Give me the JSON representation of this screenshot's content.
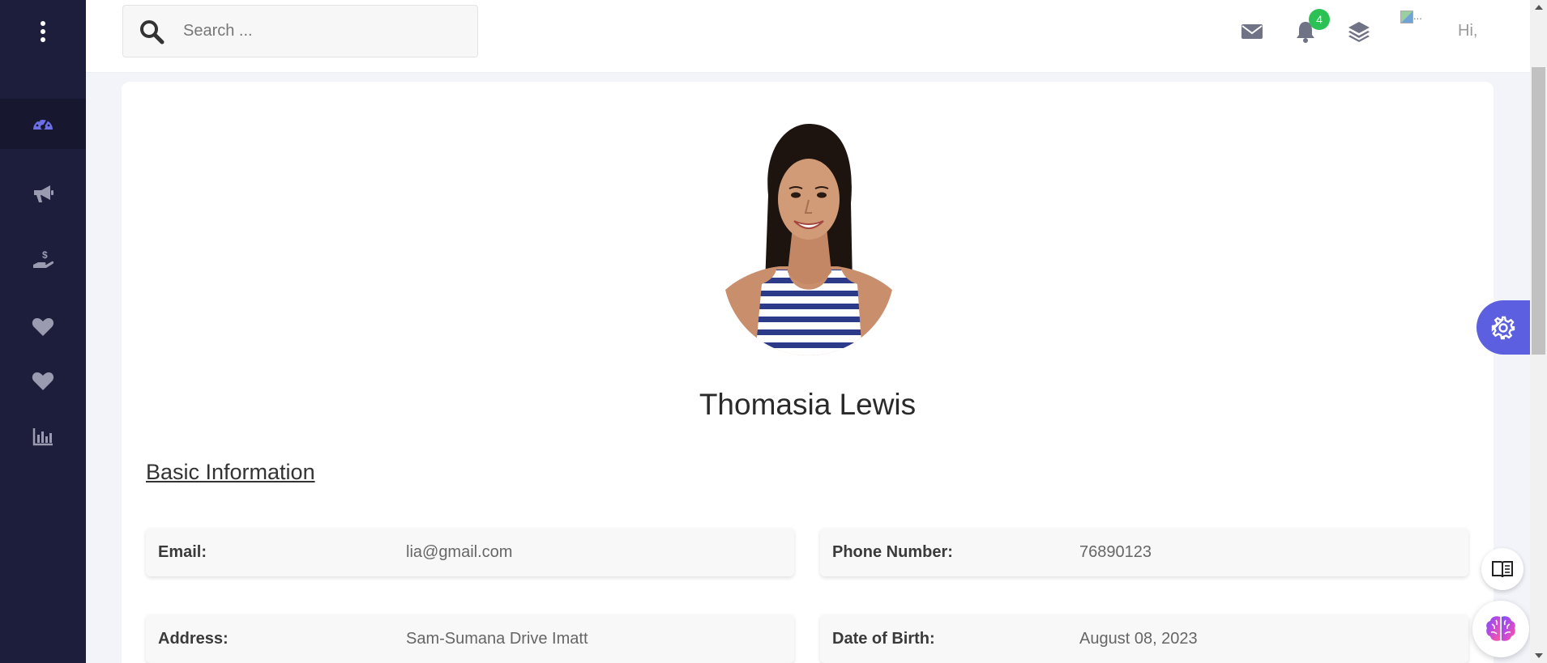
{
  "search": {
    "placeholder": "Search ..."
  },
  "header": {
    "notification_count": "4",
    "avatar_alt": "...",
    "greeting": "Hi,"
  },
  "sidebar": {
    "items": [
      {
        "icon": "dashboard-gauge-icon",
        "active": true
      },
      {
        "icon": "megaphone-icon"
      },
      {
        "icon": "hand-dollar-icon"
      },
      {
        "icon": "heart-icon"
      },
      {
        "icon": "heart-icon"
      },
      {
        "icon": "bar-chart-icon"
      }
    ]
  },
  "profile": {
    "name": "Thomasia Lewis",
    "section_title": "Basic Information",
    "fields": {
      "email": {
        "label": "Email:",
        "value": "lia@gmail.com"
      },
      "phone": {
        "label": "Phone Number:",
        "value": "76890123"
      },
      "address": {
        "label": "Address:",
        "value": "Sam-Sumana Drive Imatt"
      },
      "dob": {
        "label": "Date of Birth:",
        "value": "August 08, 2023"
      }
    }
  },
  "colors": {
    "sidebar_bg": "#1c1e3b",
    "accent": "#5b5fe0",
    "badge": "#2bc155"
  }
}
